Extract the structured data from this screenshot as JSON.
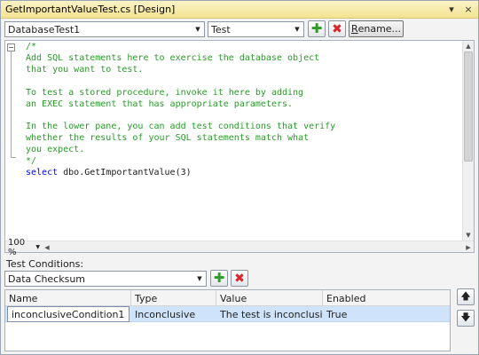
{
  "window": {
    "title": "GetImportantValueTest.cs [Design]"
  },
  "toolbar": {
    "test_combo_value": "DatabaseTest1",
    "script_combo_value": "Test",
    "rename_label_mnemonic": "R",
    "rename_label_rest": "ename..."
  },
  "editor": {
    "collapse_glyph": "−",
    "lines": [
      "/*",
      "Add SQL statements here to exercise the database object",
      "that you want to test.",
      "",
      "To test a stored procedure, invoke it here by adding",
      "an EXEC statement that has appropriate parameters.",
      "",
      "In the lower pane, you can add test conditions that verify",
      "whether the results of your SQL statements match what",
      "you expect.",
      "*/"
    ],
    "statement": {
      "keyword": "select",
      "object": " dbo.GetImportantValue(",
      "argument": "3",
      "close": ")"
    },
    "zoom": "100 %"
  },
  "test_conditions": {
    "label": "Test Conditions:",
    "type_combo_value": "Data Checksum",
    "columns": [
      "Name",
      "Type",
      "Value",
      "Enabled"
    ],
    "rows": [
      {
        "name": "inconclusiveCondition1",
        "type": "Inconclusive",
        "value": "The test is inconclusive.",
        "enabled": "True"
      }
    ]
  },
  "icons": {
    "close": "×",
    "dropdown": "▼",
    "pin": "▾",
    "add": "✚",
    "delete": "✖",
    "move_up": "🡅",
    "move_down": "🡇",
    "scroll_up": "▲",
    "scroll_down": "▼",
    "scroll_left": "◀",
    "scroll_right": "▶"
  },
  "colors": {
    "comment": "#2b9a2b",
    "keyword": "#0000ff",
    "selection": "#cfe4fa",
    "title_bar": "#f3e391"
  }
}
